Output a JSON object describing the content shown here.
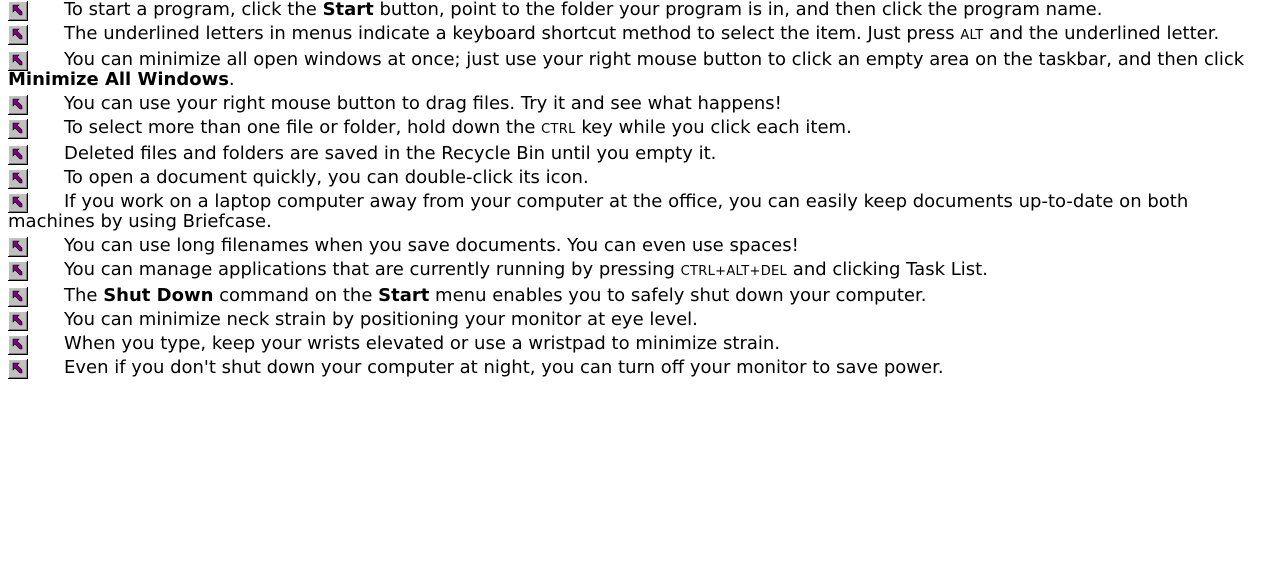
{
  "icon": {
    "name": "shortcut-arrow-icon",
    "bg": "#c0c0c0",
    "arrow": "#800080"
  },
  "tips": [
    {
      "parts": [
        {
          "t": "To start a program, click the "
        },
        {
          "t": "Start",
          "b": true
        },
        {
          "t": " button, point to the folder your program is in, and then click the program name."
        }
      ]
    },
    {
      "parts": [
        {
          "t": "The underlined letters in menus indicate a keyboard shortcut method to select the item. Just press "
        },
        {
          "t": "ALT",
          "sc": true
        },
        {
          "t": " and the underlined letter."
        }
      ]
    },
    {
      "parts": [
        {
          "t": "You can minimize all open windows at once; just use your right mouse button to click an empty area on the taskbar, and then click "
        },
        {
          "t": "Minimize All Windows",
          "b": true
        },
        {
          "t": "."
        }
      ]
    },
    {
      "parts": [
        {
          "t": "You can use your right mouse button to drag files. Try it and see what happens!"
        }
      ]
    },
    {
      "parts": [
        {
          "t": "To select more than one file or folder, hold down the "
        },
        {
          "t": "CTRL",
          "sc": true
        },
        {
          "t": " key while you click each item."
        }
      ]
    },
    {
      "parts": [
        {
          "t": "Deleted files and folders are saved in the Recycle Bin until you empty it."
        }
      ]
    },
    {
      "parts": [
        {
          "t": "To open a document quickly, you can double-click its icon."
        }
      ]
    },
    {
      "parts": [
        {
          "t": "If you work on a laptop computer away from your computer at the office, you can easily keep documents up-to-date on both machines by using Briefcase."
        }
      ]
    },
    {
      "parts": [
        {
          "t": "You can use long filenames when you save documents. You can even use spaces!"
        }
      ]
    },
    {
      "parts": [
        {
          "t": "You can manage applications that are currently running by pressing "
        },
        {
          "t": "CTRL+ALT+DEL",
          "sc": true
        },
        {
          "t": " and clicking Task List."
        }
      ]
    },
    {
      "parts": [
        {
          "t": "The "
        },
        {
          "t": "Shut Down",
          "b": true
        },
        {
          "t": " command on the "
        },
        {
          "t": "Start",
          "b": true
        },
        {
          "t": " menu enables you to safely shut down your computer."
        }
      ]
    },
    {
      "parts": [
        {
          "t": "You can minimize neck strain by positioning your monitor at eye level."
        }
      ]
    },
    {
      "parts": [
        {
          "t": "When you type, keep your wrists elevated or use a wristpad to minimize strain."
        }
      ]
    },
    {
      "parts": [
        {
          "t": "Even if you don't shut down your computer at night, you can turn off your monitor to save power."
        }
      ]
    }
  ]
}
